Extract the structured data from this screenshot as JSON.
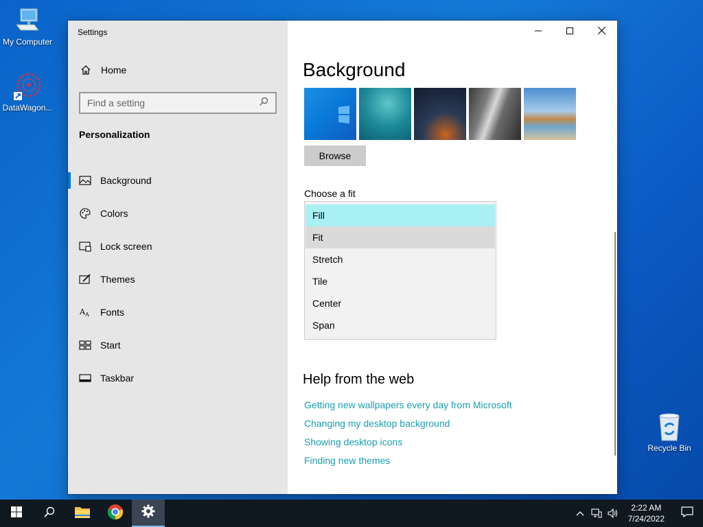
{
  "desktop": {
    "icons": [
      {
        "label": "My Computer",
        "icon": "computer-icon"
      },
      {
        "label": "DataWagon...",
        "icon": "datawagon-shortcut-icon"
      },
      {
        "label": "Recycle Bin",
        "icon": "recycle-bin-icon"
      }
    ]
  },
  "window": {
    "title": "Settings",
    "controls": [
      "minimize",
      "maximize",
      "close"
    ]
  },
  "sidebar": {
    "home_label": "Home",
    "search_placeholder": "Find a setting",
    "section": "Personalization",
    "items": [
      {
        "label": "Background",
        "icon": "picture-icon",
        "active": true
      },
      {
        "label": "Colors",
        "icon": "palette-icon"
      },
      {
        "label": "Lock screen",
        "icon": "lock-screen-icon"
      },
      {
        "label": "Themes",
        "icon": "brush-icon"
      },
      {
        "label": "Fonts",
        "icon": "fonts-icon"
      },
      {
        "label": "Start",
        "icon": "start-icon"
      },
      {
        "label": "Taskbar",
        "icon": "taskbar-icon"
      }
    ]
  },
  "main": {
    "title": "Background",
    "browse_label": "Browse",
    "fit_label": "Choose a fit",
    "fit_options": [
      {
        "label": "Fill",
        "state": "selected"
      },
      {
        "label": "Fit",
        "state": "hover"
      },
      {
        "label": "Stretch"
      },
      {
        "label": "Tile"
      },
      {
        "label": "Center"
      },
      {
        "label": "Span"
      }
    ],
    "help_title": "Help from the web",
    "help_links": [
      "Getting new wallpapers every day from Microsoft",
      "Changing my desktop background",
      "Showing desktop icons",
      "Finding new themes"
    ]
  },
  "taskbar": {
    "buttons": [
      "start-icon",
      "search-icon",
      "file-explorer-icon",
      "chrome-icon",
      "settings-gear-icon"
    ],
    "time": "2:22 AM",
    "date": "7/24/2022"
  },
  "colors": {
    "accent": "#0078d7",
    "link": "#1a9fb0",
    "selected_option": "#a8f0f4"
  }
}
